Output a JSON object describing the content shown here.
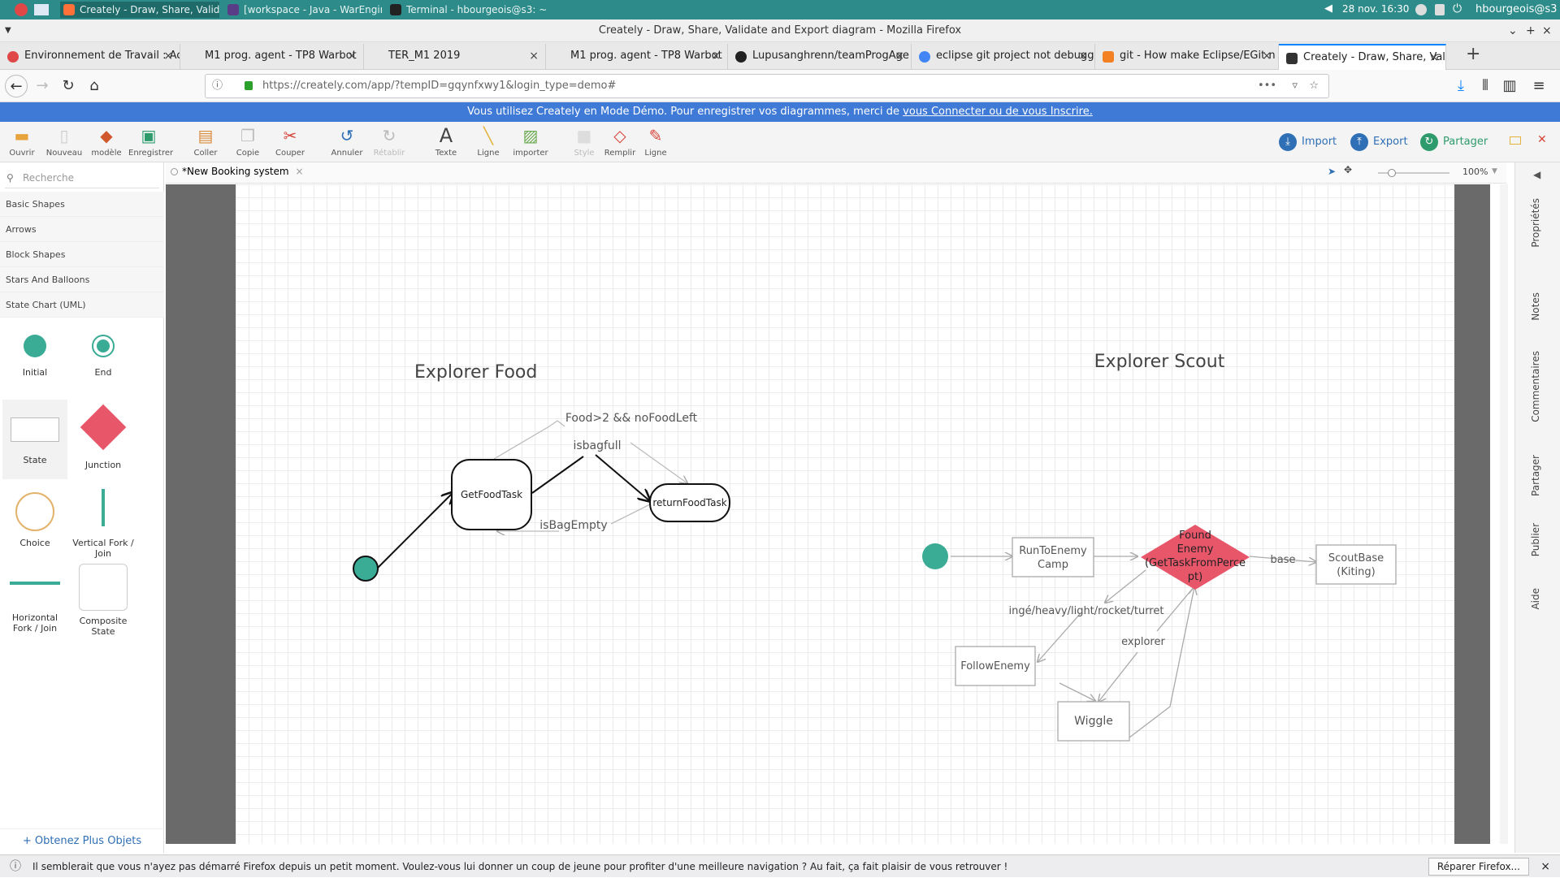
{
  "os": {
    "tasks": [
      "Creately - Draw, Share, Valid...",
      "[workspace - Java - WarEngin...",
      "Terminal - hbourgeois@s3: ~..."
    ],
    "datetime": "28 nov. 16:30",
    "user": "hbourgeois@s3"
  },
  "window": {
    "title": "Creately - Draw, Share, Validate and Export diagram - Mozilla Firefox"
  },
  "tabs": [
    {
      "label": "Environnement de Travail : Ac",
      "color": "#e04848"
    },
    {
      "label": "M1 prog. agent - TP8 Warbot",
      "color": ""
    },
    {
      "label": "TER_M1 2019",
      "color": ""
    },
    {
      "label": "M1 prog. agent - TP8 Warbot",
      "color": ""
    },
    {
      "label": "Lupusanghrenn/teamProgAge",
      "color": "#222222"
    },
    {
      "label": "eclipse git project not debugg",
      "color": "#4285f4"
    },
    {
      "label": "git - How make Eclipse/EGit n",
      "color": "#f48024"
    },
    {
      "label": "Creately - Draw, Share, Valida",
      "color": "#333333"
    }
  ],
  "nav": {
    "url": "https://creately.com/app/?tempID=gqynfxwy1&login_type=demo#"
  },
  "banner": {
    "text": "Vous utilisez Creately en Mode Démo. Pour enregistrer vos diagrammes, merci de ",
    "link": "vous Connecter ou de vous Inscrire."
  },
  "toolbar": {
    "tools": [
      {
        "label": "Ouvrir",
        "icon": "folder-icon"
      },
      {
        "label": "Nouveau",
        "icon": "new-doc-icon"
      },
      {
        "label": "modèle",
        "icon": "template-icon"
      },
      {
        "label": "Enregistrer",
        "icon": "save-icon"
      },
      {
        "label": "Coller",
        "icon": "paste-icon"
      },
      {
        "label": "Copie",
        "icon": "copy-icon"
      },
      {
        "label": "Couper",
        "icon": "scissors-icon"
      },
      {
        "label": "Annuler",
        "icon": "undo-icon"
      },
      {
        "label": "Rétablir",
        "icon": "redo-icon"
      },
      {
        "label": "Texte",
        "icon": "text-icon"
      },
      {
        "label": "Ligne",
        "icon": "line-icon"
      },
      {
        "label": "importer",
        "icon": "image-icon"
      },
      {
        "label": "Style",
        "icon": "style-icon"
      },
      {
        "label": "Remplir",
        "icon": "fill-icon"
      },
      {
        "label": "Ligne",
        "icon": "pen-icon"
      }
    ],
    "import": "Import",
    "export": "Export",
    "share": "Partager"
  },
  "library": {
    "search_placeholder": "Recherche",
    "categories": [
      "Basic Shapes",
      "Arrows",
      "Block Shapes",
      "Stars And Balloons",
      "State Chart (UML)"
    ],
    "shapes": [
      "Initial",
      "End",
      "State",
      "Junction",
      "Choice",
      "Vertical Fork / Join",
      "Horizontal Fork / Join",
      "Composite State"
    ],
    "more": "+ Obtenez Plus Objets"
  },
  "doc": {
    "tab": "*New Booking system",
    "zoom": "100%"
  },
  "diagram": {
    "food_title": "Explorer Food",
    "scout_title": "Explorer Scout",
    "get_food": "GetFoodTask",
    "return_food": "returnFoodTask",
    "lbl_food": "Food>2 && noFoodLeft",
    "lbl_full": "isbagfull",
    "lbl_empty": "isBagEmpty",
    "run_camp": [
      "RunToEnemy",
      "Camp"
    ],
    "found": [
      "Found",
      "Enemy",
      "(GetTaskFromPerce",
      "pt)"
    ],
    "scout_base": [
      "ScoutBase",
      "(Kiting)"
    ],
    "follow": "FollowEnemy",
    "wiggle": "Wiggle",
    "lbl_base": "base",
    "lbl_types": "ingé/heavy/light/rocket/turret",
    "lbl_explorer": "explorer"
  },
  "rightpanel": [
    "Propriétés",
    "Notes",
    "Commentaires",
    "Partager",
    "Publier",
    "Aide"
  ],
  "notif": {
    "text": "Il semblerait que vous n'ayez pas démarré Firefox depuis un petit moment. Voulez-vous lui donner un coup de jeune pour profiter d'une meilleure navigation ? Au fait, ça fait plaisir de vous retrouver !",
    "button": "Réparer Firefox..."
  },
  "colors": {
    "accent": "#3f7ad6",
    "teal": "#3aab95",
    "junction": "#e8566a",
    "choice": "#e3b36b"
  }
}
